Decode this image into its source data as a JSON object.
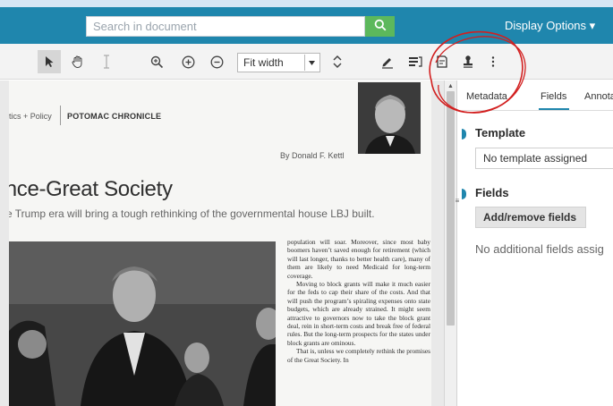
{
  "header": {
    "search": {
      "placeholder": "Search in document"
    },
    "display_options_label": "Display Options ▾"
  },
  "toolbar": {
    "tools": [
      "select-icon",
      "pan-hand-icon",
      "text-cursor-icon",
      "zoom-magnify-icon",
      "zoom-in-icon",
      "zoom-out-icon"
    ],
    "zoom": {
      "selected": "Fit width"
    },
    "right_tools": [
      "rotate-icon",
      "annotate-pen-icon",
      "list-icon",
      "note-icon",
      "stamp-icon",
      "more-icon"
    ]
  },
  "document": {
    "kicker": "tics + Policy",
    "masthead": "POTOMAC CHRONICLE",
    "byline": "By Donald F. Kettl",
    "headline": ")nce-Great Society",
    "dek": "e Trump era will bring a tough rethinking of the governmental house LBJ built.",
    "body_paragraphs": [
      "population will soar. Moreover, since most baby boomers haven’t saved enough for retirement (which will last longer, thanks to better health care), many of them are likely to need Medicaid for long-term coverage.",
      "Moving to block grants will make it much easier for the feds to cap their share of the costs. And that will push the program’s spiraling expenses onto state budgets, which are already strained. It might seem attractive to governors now to take the block grant deal, rein in short-term costs and break free of federal rules. But the long-term prospects for the states under block grants are ominous.",
      "That is, unless we completely rethink the promises of the Great Society. In"
    ]
  },
  "panel": {
    "tabs": [
      "Metadata",
      "Fields",
      "Annota"
    ],
    "active_tab": "Fields",
    "template": {
      "title": "Template",
      "value": "No template assigned"
    },
    "fields": {
      "title": "Fields",
      "button": "Add/remove fields",
      "empty": "No additional fields assig"
    }
  },
  "colors": {
    "header": "#1f86ad",
    "search_button": "#5cb85c",
    "annotation": "#d21f1f"
  }
}
